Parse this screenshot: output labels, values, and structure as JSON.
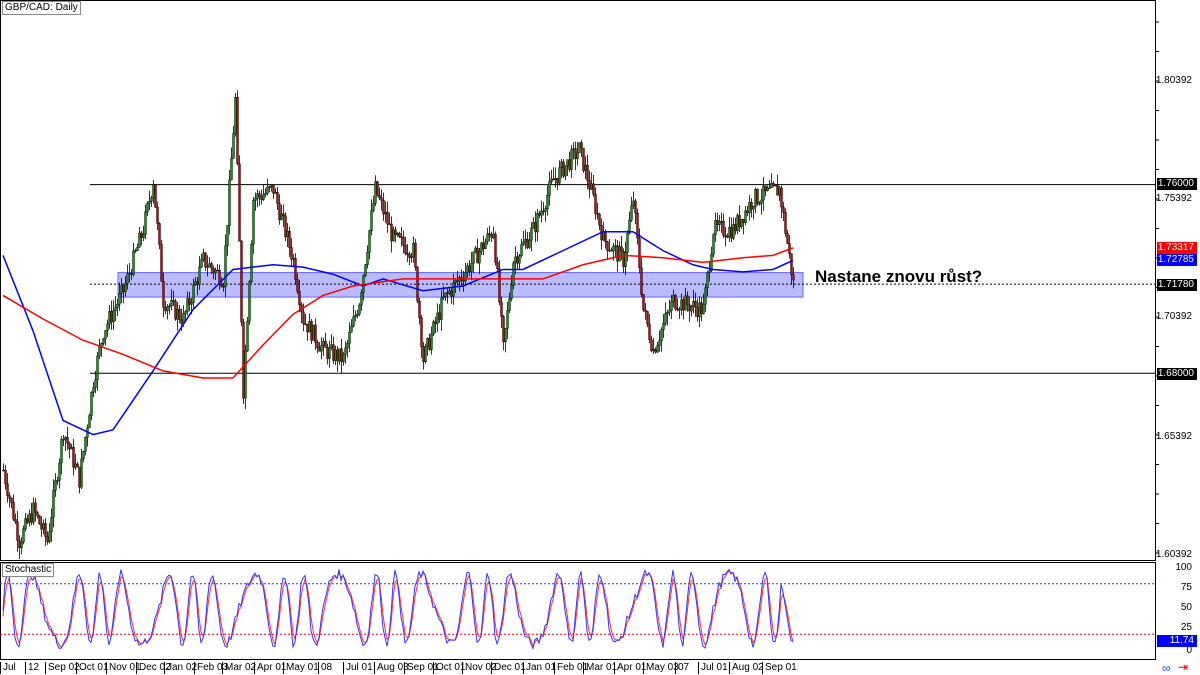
{
  "header": {
    "symbol_label": "GBP/CAD: Daily"
  },
  "indicator": {
    "name": "Stochastic",
    "current_value": "11.74",
    "levels": [
      80,
      20
    ]
  },
  "annotation": {
    "text": "Nastane znovu růst?"
  },
  "price_axis": {
    "ticks": [
      "1.80392",
      "1.75392",
      "1.70392",
      "1.65392",
      "1.60392"
    ],
    "tags": {
      "resistance": "1.76000",
      "ma_red": "1.73317",
      "ma_blue": "1.72785",
      "current": "1.71780",
      "support": "1.68000"
    }
  },
  "stoch_axis": {
    "ticks": [
      "100",
      "75",
      "50",
      "25",
      "0"
    ]
  },
  "date_axis": [
    "Jul",
    "",
    "12",
    "Sep 02",
    "Oct 01",
    "Nov 01",
    "Dec 02",
    "Jan 02",
    "Feb 03",
    "Mar 02",
    "Apr 01",
    "May 01",
    "08",
    "Jul 01",
    "Aug 03",
    "Sep 01",
    "Oct 01",
    "Nov 02",
    "Dec 01",
    "Jan 01",
    "Feb 01",
    "Mar 01",
    "Apr 01",
    "May 03",
    "07",
    "Jul 01",
    "Aug 02",
    "Sep 01"
  ],
  "colors": {
    "bull": "#00a000",
    "bear": "#d00000",
    "ma_red": "#ff0000",
    "ma_blue": "#0000ff",
    "zone": "#6666ff"
  },
  "chart_data": {
    "type": "candlestick",
    "title": "GBP/CAD: Daily",
    "ylim": [
      1.599,
      1.838
    ],
    "levels": {
      "resistance": 1.76,
      "support": 1.68,
      "current": 1.7178,
      "zone": [
        1.714,
        1.721
      ]
    },
    "price_path": [
      [
        0,
        1.639
      ],
      [
        8,
        1.609
      ],
      [
        15,
        1.622
      ],
      [
        22,
        1.609
      ],
      [
        30,
        1.656
      ],
      [
        38,
        1.635
      ],
      [
        45,
        1.677
      ],
      [
        50,
        1.698
      ],
      [
        60,
        1.715
      ],
      [
        70,
        1.741
      ],
      [
        75,
        1.762
      ],
      [
        80,
        1.711
      ],
      [
        90,
        1.703
      ],
      [
        100,
        1.728
      ],
      [
        110,
        1.72
      ],
      [
        116,
        1.796
      ],
      [
        120,
        1.673
      ],
      [
        125,
        1.754
      ],
      [
        135,
        1.758
      ],
      [
        145,
        1.728
      ],
      [
        150,
        1.703
      ],
      [
        160,
        1.69
      ],
      [
        170,
        1.686
      ],
      [
        178,
        1.711
      ],
      [
        186,
        1.758
      ],
      [
        195,
        1.737
      ],
      [
        205,
        1.732
      ],
      [
        210,
        1.686
      ],
      [
        220,
        1.711
      ],
      [
        235,
        1.728
      ],
      [
        245,
        1.741
      ],
      [
        250,
        1.69
      ],
      [
        255,
        1.728
      ],
      [
        265,
        1.741
      ],
      [
        275,
        1.762
      ],
      [
        288,
        1.775
      ],
      [
        295,
        1.754
      ],
      [
        300,
        1.737
      ],
      [
        310,
        1.728
      ],
      [
        315,
        1.754
      ],
      [
        320,
        1.707
      ],
      [
        325,
        1.69
      ],
      [
        335,
        1.711
      ],
      [
        350,
        1.707
      ],
      [
        355,
        1.741
      ],
      [
        365,
        1.741
      ],
      [
        375,
        1.754
      ],
      [
        388,
        1.758
      ],
      [
        395,
        1.718
      ]
    ],
    "ma_blue": [
      [
        0,
        1.73
      ],
      [
        15,
        1.698
      ],
      [
        30,
        1.66
      ],
      [
        45,
        1.654
      ],
      [
        55,
        1.656
      ],
      [
        75,
        1.681
      ],
      [
        95,
        1.707
      ],
      [
        115,
        1.724
      ],
      [
        135,
        1.726
      ],
      [
        150,
        1.725
      ],
      [
        165,
        1.722
      ],
      [
        180,
        1.717
      ],
      [
        190,
        1.72
      ],
      [
        210,
        1.715
      ],
      [
        230,
        1.717
      ],
      [
        250,
        1.724
      ],
      [
        260,
        1.724
      ],
      [
        280,
        1.732
      ],
      [
        300,
        1.74
      ],
      [
        315,
        1.74
      ],
      [
        330,
        1.732
      ],
      [
        345,
        1.726
      ],
      [
        355,
        1.724
      ],
      [
        370,
        1.723
      ],
      [
        385,
        1.724
      ],
      [
        395,
        1.72785
      ]
    ],
    "ma_red": [
      [
        0,
        1.713
      ],
      [
        20,
        1.703
      ],
      [
        40,
        1.694
      ],
      [
        60,
        1.688
      ],
      [
        80,
        1.681
      ],
      [
        100,
        1.678
      ],
      [
        115,
        1.678
      ],
      [
        130,
        1.692
      ],
      [
        145,
        1.705
      ],
      [
        160,
        1.713
      ],
      [
        175,
        1.717
      ],
      [
        200,
        1.72
      ],
      [
        225,
        1.72
      ],
      [
        250,
        1.72
      ],
      [
        270,
        1.72
      ],
      [
        290,
        1.726
      ],
      [
        310,
        1.73
      ],
      [
        330,
        1.729
      ],
      [
        350,
        1.727
      ],
      [
        370,
        1.729
      ],
      [
        385,
        1.73
      ],
      [
        395,
        1.73317
      ]
    ]
  }
}
